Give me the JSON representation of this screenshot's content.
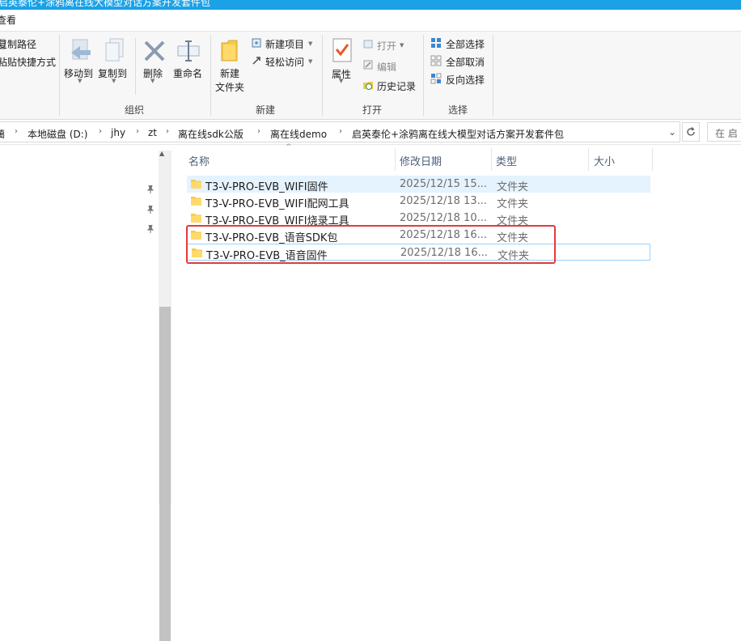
{
  "window": {
    "title": "启英泰伦+涂鸦离在线大模型对话方案开发套件包"
  },
  "menu": {
    "tab_view": "查看"
  },
  "ribbon": {
    "clipboard": {
      "copy_path": "复制路径",
      "paste_shortcut": "粘贴快捷方式"
    },
    "organize": {
      "label": "组织",
      "move_to": "移动到",
      "copy_to": "复制到",
      "delete": "删除",
      "rename": "重命名"
    },
    "new": {
      "label": "新建",
      "new_folder_line1": "新建",
      "new_folder_line2": "文件夹",
      "new_item": "新建项目",
      "easy_access": "轻松访问"
    },
    "open": {
      "label": "打开",
      "properties": "属性",
      "open": "打开",
      "edit": "编辑",
      "history": "历史记录"
    },
    "select": {
      "label": "选择",
      "select_all": "全部选择",
      "select_none": "全部取消",
      "invert": "反向选择"
    }
  },
  "address": {
    "crumbs": [
      "本地磁盘 (D:)",
      "jhy",
      "zt",
      "离在线sdk公版",
      "离在线demo",
      "启英泰伦+涂鸦离在线大模型对话方案开发套件包"
    ],
    "search_placeholder": "在 启"
  },
  "columns": {
    "name": "名称",
    "date": "修改日期",
    "type": "类型",
    "size": "大小"
  },
  "files": [
    {
      "name": "T3-V-PRO-EVB_WIFI固件",
      "date": "2025/12/15 15...",
      "type": "文件夹"
    },
    {
      "name": "T3-V-PRO-EVB_WIFI配网工具",
      "date": "2025/12/18 13...",
      "type": "文件夹"
    },
    {
      "name": "T3-V-PRO-EVB_WIFI烧录工具",
      "date": "2025/12/18 10...",
      "type": "文件夹"
    },
    {
      "name": "T3-V-PRO-EVB_语音SDK包",
      "date": "2025/12/18 16...",
      "type": "文件夹"
    },
    {
      "name": "T3-V-PRO-EVB_语音固件",
      "date": "2025/12/18 16...",
      "type": "文件夹"
    }
  ],
  "colors": {
    "titlebar": "#1aa1e6",
    "highlight": "#e23b3b",
    "selection": "#e5f3ff"
  }
}
